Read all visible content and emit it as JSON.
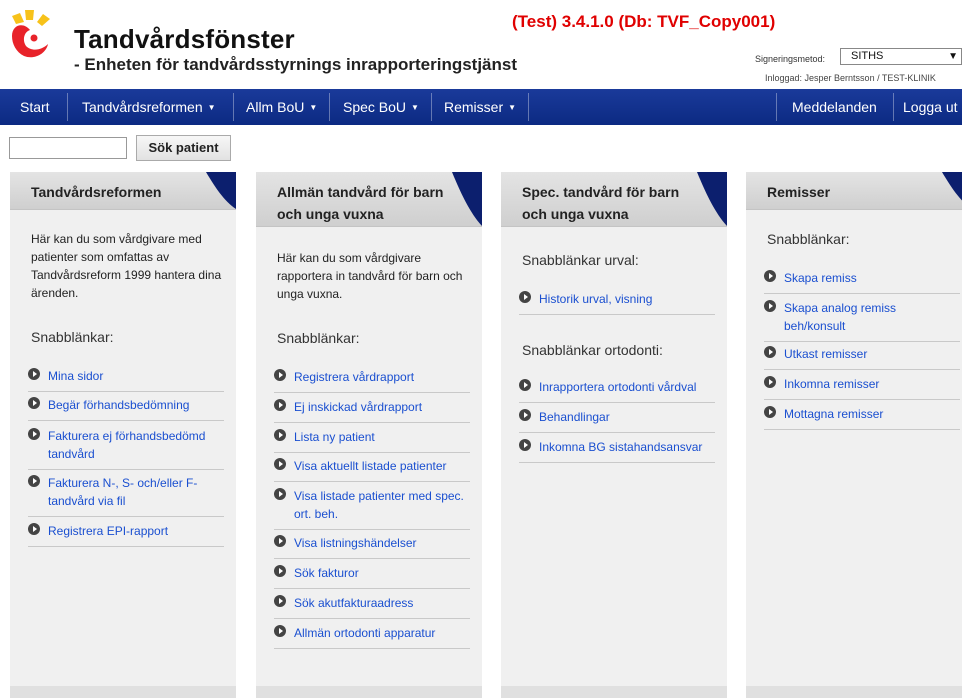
{
  "header": {
    "title": "Tandvårdsfönster",
    "subtitle": "- Enheten för tandvårdsstyrnings inrapporteringstjänst",
    "environment": "(Test) 3.4.1.0 (Db: TVF_Copy001)",
    "signing_label": "Signeringsmetod:",
    "signing_value": "SITHS",
    "logged_in": "Inloggad: Jesper Berntsson / TEST-KLINIK"
  },
  "nav": {
    "start": "Start",
    "tandvardsreformen": "Tandvårdsreformen",
    "allm_bou": "Allm BoU",
    "spec_bou": "Spec BoU",
    "remisser": "Remisser",
    "meddelanden": "Meddelanden",
    "logga_ut": "Logga ut"
  },
  "search": {
    "placeholder": "",
    "button": "Sök patient"
  },
  "panels": {
    "reform": {
      "title": "Tandvårdsreformen",
      "description": "Här kan du som vårdgivare med patienter som omfattas av Tandvårdsreform 1999 hantera dina ärenden.",
      "snabb": "Snabblänkar:",
      "links": [
        "Mina sidor",
        "Begär förhandsbedömning",
        "Fakturera ej förhandsbedömd tandvård",
        "Fakturera N-, S- och/eller F-tandvård via fil",
        "Registrera EPI-rapport"
      ]
    },
    "allman": {
      "title": "Allmän tandvård för barn och unga vuxna",
      "description": "Här kan du som vårdgivare rapportera in tandvård för barn och unga vuxna.",
      "snabb": "Snabblänkar:",
      "links": [
        "Registrera vårdrapport",
        "Ej inskickad vårdrapport",
        "Lista ny patient",
        "Visa aktuellt listade patienter",
        "Visa listade patienter med spec. ort. beh.",
        "Visa listningshändelser",
        "Sök fakturor",
        "Sök akutfakturaadress",
        "Allmän ortodonti apparatur"
      ]
    },
    "spec": {
      "title": "Spec. tandvård för barn och unga vuxna",
      "snabb_urval": "Snabblänkar urval:",
      "urval_links": [
        "Historik urval, visning"
      ],
      "snabb_ortodonti": "Snabblänkar ortodonti:",
      "ortodonti_links": [
        "Inrapportera ortodonti vårdval",
        "Behandlingar",
        "Inkomna BG sistahandsansvar"
      ]
    },
    "remisser": {
      "title": "Remisser",
      "snabb": "Snabblänkar:",
      "links": [
        "Skapa remiss",
        "Skapa analog remiss beh/konsult",
        "Utkast remisser",
        "Inkomna remisser",
        "Mottagna remisser"
      ]
    }
  },
  "colors": {
    "nav_bg": "#0c2a82",
    "link": "#1a4fd0",
    "env_text": "#e00000",
    "corner": "#0c1f6e"
  }
}
